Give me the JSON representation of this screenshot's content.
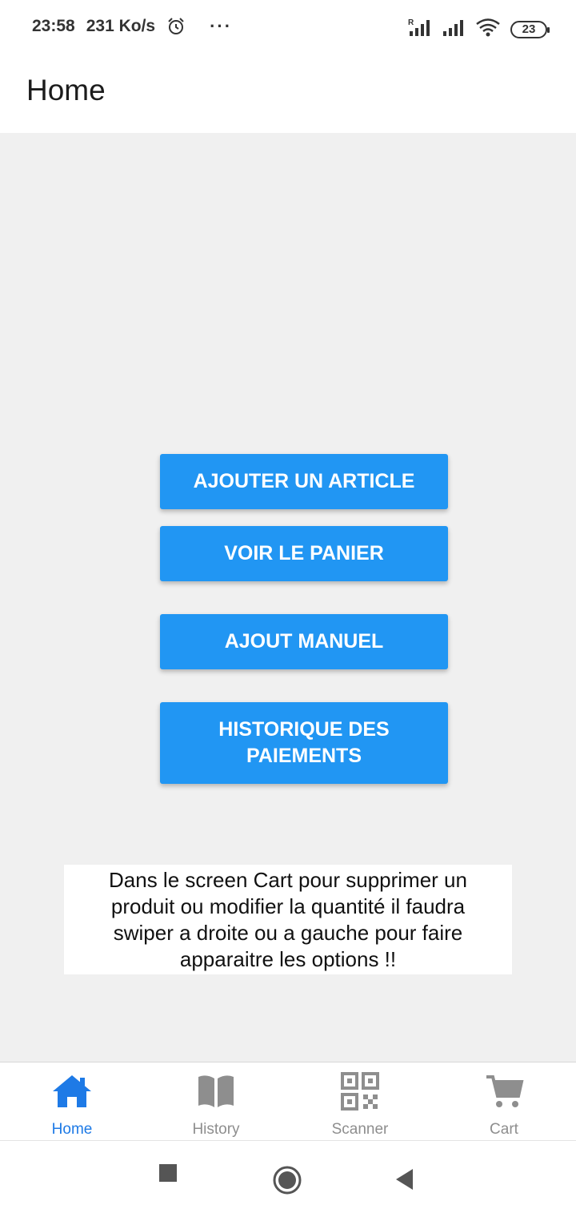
{
  "status_bar": {
    "time": "23:58",
    "speed": "231 Ko/s",
    "more": "···",
    "battery": "23",
    "icons": [
      "alarm-icon",
      "signal-roaming-icon",
      "signal-icon",
      "wifi-icon",
      "battery-icon"
    ]
  },
  "header": {
    "title": "Home"
  },
  "buttons": [
    {
      "label": "AJOUTER UN ARTICLE"
    },
    {
      "label": "VOIR LE PANIER"
    },
    {
      "label": "AJOUT MANUEL"
    },
    {
      "label": "HISTORIQUE DES PAIEMENTS"
    }
  ],
  "info_text": "Dans le screen Cart pour supprimer un produit ou modifier la quantité il faudra swiper a droite ou a gauche pour faire apparaitre les options !!",
  "tabs": [
    {
      "label": "Home",
      "icon": "home-icon",
      "active": true
    },
    {
      "label": "History",
      "icon": "book-icon",
      "active": false
    },
    {
      "label": "Scanner",
      "icon": "qr-code-icon",
      "active": false
    },
    {
      "label": "Cart",
      "icon": "cart-icon",
      "active": false
    }
  ],
  "nav_bar": {
    "icons": [
      "recents-icon",
      "home-circle-icon",
      "back-icon"
    ]
  },
  "colors": {
    "accent": "#2196f3",
    "active_tab": "#1e7ae6",
    "inactive_tab": "#8e8e8e",
    "background": "#f0f0f0"
  }
}
